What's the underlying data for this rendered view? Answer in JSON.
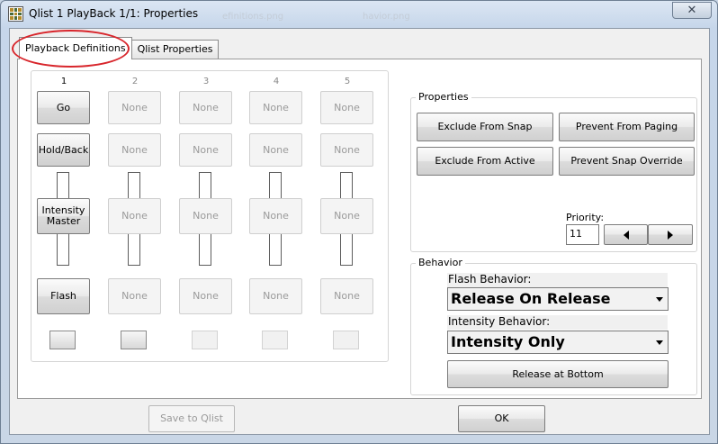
{
  "window": {
    "title": "Qlist 1 PlayBack 1/1: Properties",
    "close_glyph": "✕",
    "background_titles": [
      "efinitions.png",
      "havior.png"
    ]
  },
  "tabs": [
    {
      "label": "Playback Definitions",
      "active": true
    },
    {
      "label": "Qlist Properties",
      "active": false
    }
  ],
  "playback_columns": [
    {
      "number": "1",
      "go": "Go",
      "hold_back": "Hold/Back",
      "intensity": "Intensity Master",
      "flash": "Flash",
      "enabled": true
    },
    {
      "number": "2",
      "go": "None",
      "hold_back": "None",
      "intensity": "None",
      "flash": "None",
      "enabled": false
    },
    {
      "number": "3",
      "go": "None",
      "hold_back": "None",
      "intensity": "None",
      "flash": "None",
      "enabled": false
    },
    {
      "number": "4",
      "go": "None",
      "hold_back": "None",
      "intensity": "None",
      "flash": "None",
      "enabled": false
    },
    {
      "number": "5",
      "go": "None",
      "hold_back": "None",
      "intensity": "None",
      "flash": "None",
      "enabled": false
    }
  ],
  "properties": {
    "label": "Properties",
    "exclude_from_snap": "Exclude From Snap",
    "prevent_from_paging": "Prevent From Paging",
    "exclude_from_active": "Exclude From Active",
    "prevent_snap_override": "Prevent Snap Override",
    "priority_label": "Priority:",
    "priority_value": "11"
  },
  "behavior": {
    "label": "Behavior",
    "flash_label": "Flash Behavior:",
    "flash_value": "Release On Release",
    "intensity_label": "Intensity Behavior:",
    "intensity_value": "Intensity Only",
    "release_button": "Release at Bottom"
  },
  "footer": {
    "save_label": "Save to Qlist",
    "ok_label": "OK"
  },
  "annotation_color": "#d8262c"
}
